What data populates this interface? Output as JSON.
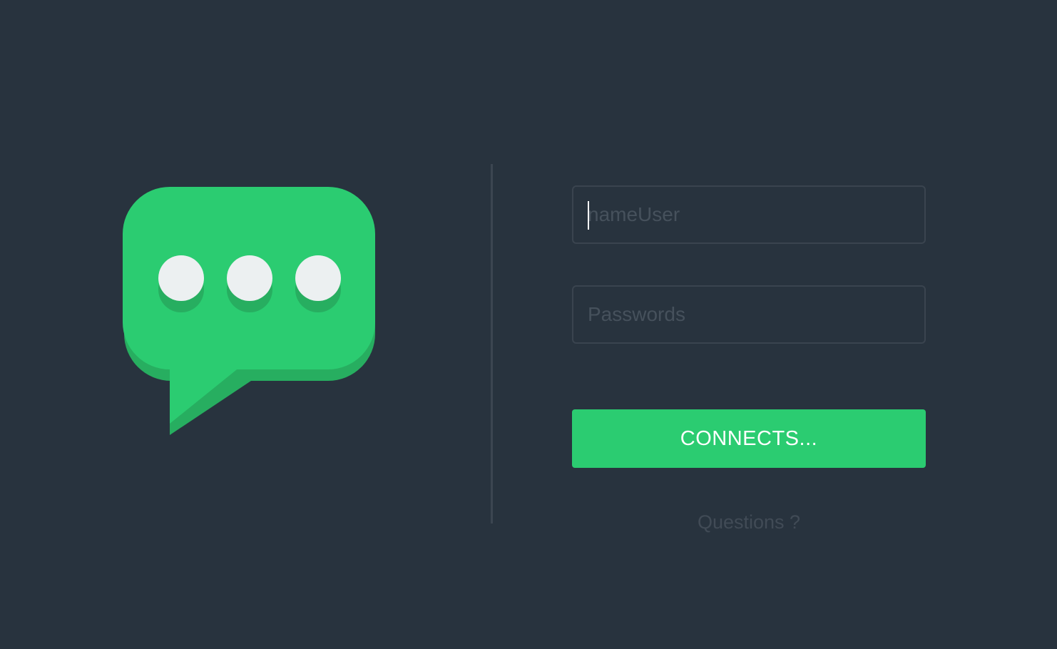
{
  "colors": {
    "background": "#28333e",
    "accent": "#2bcc71",
    "accent_shadow": "#27ae60",
    "dot": "#ecf0f1",
    "divider": "#3c4651",
    "field_border": "#3a444f",
    "placeholder": "#46515c",
    "link": "#414b56"
  },
  "logo": {
    "icon": "chat-bubble-icon"
  },
  "login_form": {
    "username": {
      "placeholder": "nameUser",
      "value": ""
    },
    "password": {
      "placeholder": "Passwords",
      "value": ""
    },
    "connect_label": "CONNECTS...",
    "questions_label": "Questions ?"
  }
}
